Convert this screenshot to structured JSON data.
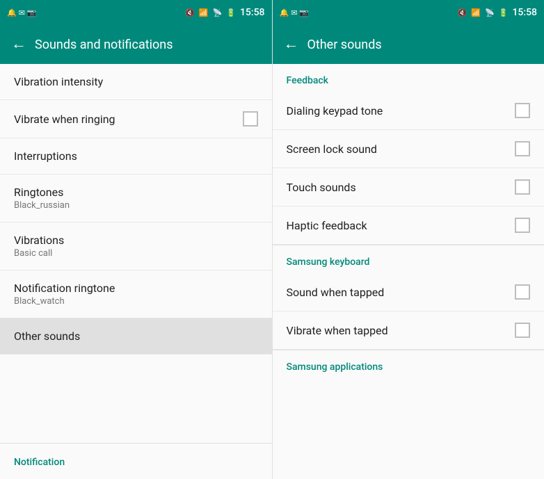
{
  "left": {
    "status": {
      "time": "15:58"
    },
    "header": {
      "back": "←",
      "title": "Sounds and notifications"
    },
    "items": [
      {
        "id": "vibration-intensity",
        "title": "Vibration intensity",
        "subtitle": null,
        "hasCheckbox": false,
        "active": false
      },
      {
        "id": "vibrate-ringing",
        "title": "Vibrate when ringing",
        "subtitle": null,
        "hasCheckbox": true,
        "checked": false,
        "active": false
      },
      {
        "id": "interruptions",
        "title": "Interruptions",
        "subtitle": null,
        "hasCheckbox": false,
        "active": false
      },
      {
        "id": "ringtones",
        "title": "Ringtones",
        "subtitle": "Black_russian",
        "hasCheckbox": false,
        "active": false
      },
      {
        "id": "vibrations",
        "title": "Vibrations",
        "subtitle": "Basic call",
        "hasCheckbox": false,
        "active": false
      },
      {
        "id": "notification-ringtone",
        "title": "Notification ringtone",
        "subtitle": "Black_watch",
        "hasCheckbox": false,
        "active": false
      },
      {
        "id": "other-sounds",
        "title": "Other sounds",
        "subtitle": null,
        "hasCheckbox": false,
        "active": true
      }
    ],
    "bottom_nav_label": "Notification"
  },
  "right": {
    "status": {
      "time": "15:58"
    },
    "header": {
      "back": "←",
      "title": "Other sounds"
    },
    "sections": [
      {
        "label": "Feedback",
        "items": [
          {
            "id": "dialing-keypad-tone",
            "title": "Dialing keypad tone",
            "checked": false
          },
          {
            "id": "screen-lock-sound",
            "title": "Screen lock sound",
            "checked": false
          },
          {
            "id": "touch-sounds",
            "title": "Touch sounds",
            "checked": false
          },
          {
            "id": "haptic-feedback",
            "title": "Haptic feedback",
            "checked": false
          }
        ]
      },
      {
        "label": "Samsung keyboard",
        "items": [
          {
            "id": "sound-when-tapped",
            "title": "Sound when tapped",
            "checked": false
          },
          {
            "id": "vibrate-when-tapped",
            "title": "Vibrate when tapped",
            "checked": false
          }
        ]
      },
      {
        "label": "Samsung applications",
        "items": []
      }
    ]
  }
}
